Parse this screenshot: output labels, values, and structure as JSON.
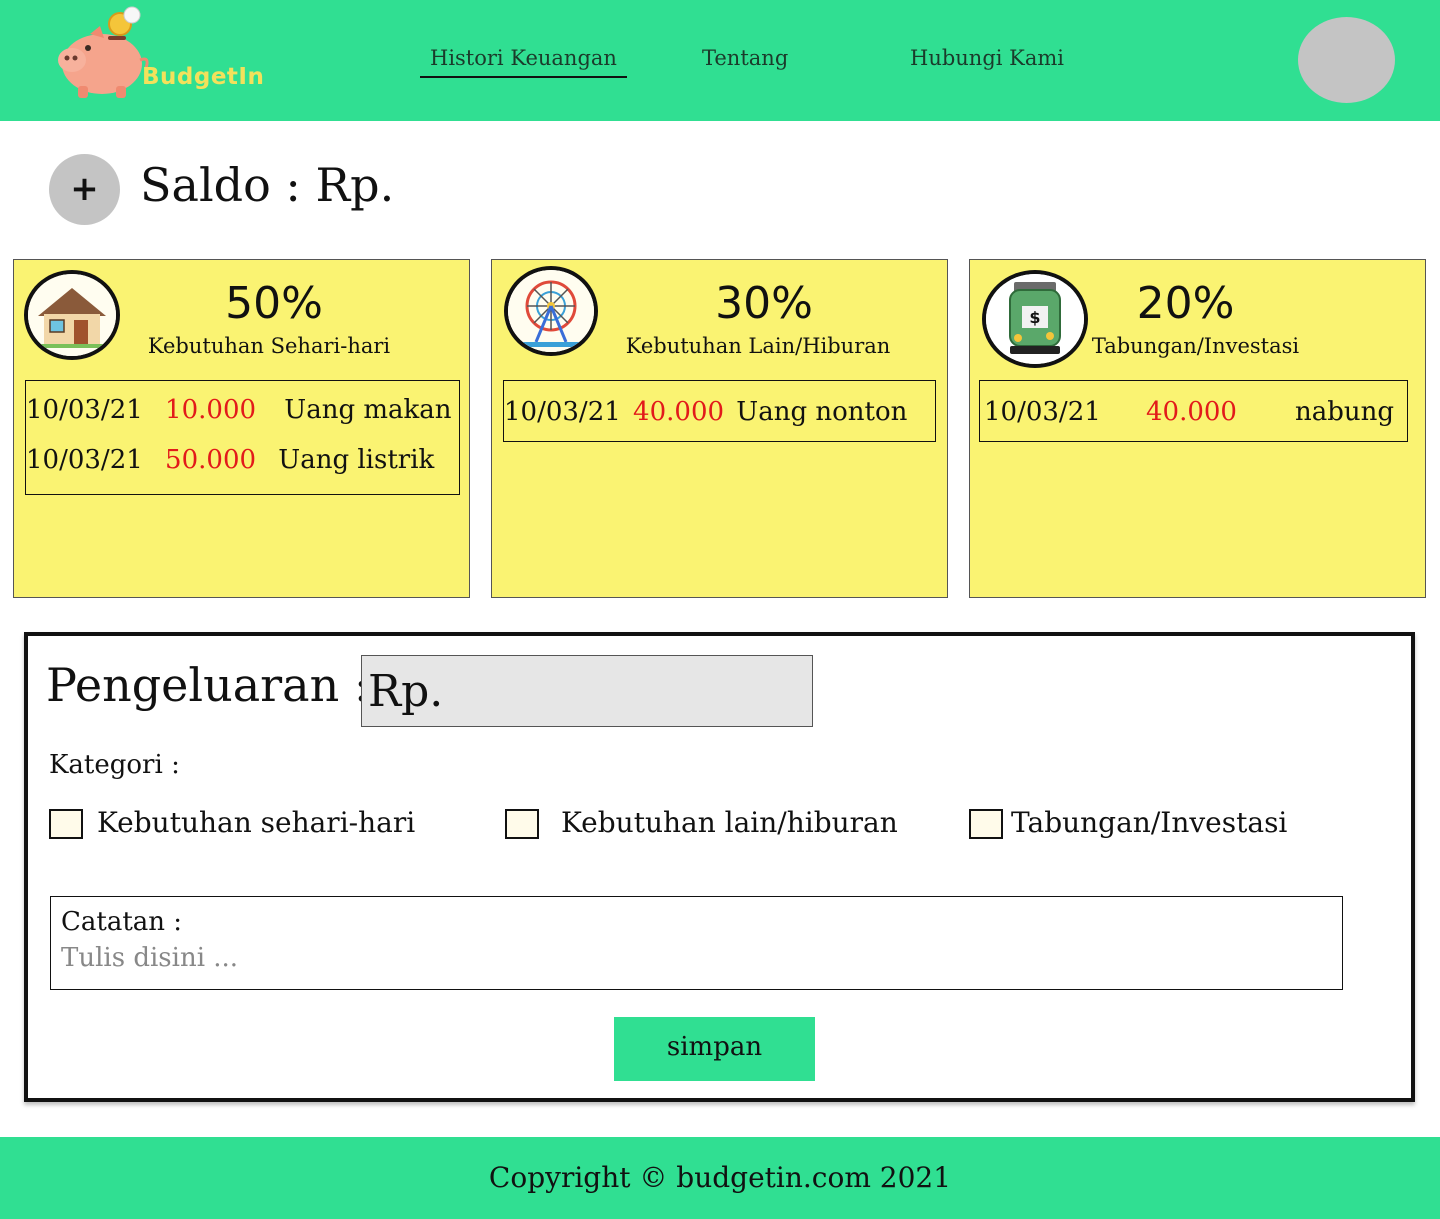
{
  "header": {
    "logo_text": "BudgetIn",
    "nav": [
      {
        "label": "Histori Keuangan",
        "active": true
      },
      {
        "label": "Tentang",
        "active": false
      },
      {
        "label": "Hubungi Kami",
        "active": false
      }
    ]
  },
  "balance": {
    "add_label": "+",
    "label": "Saldo : Rp."
  },
  "categories": [
    {
      "percent": "50%",
      "label": "Kebutuhan Sehari-hari",
      "icon": "house-icon",
      "transactions": [
        {
          "date": "10/03/21",
          "amount": "10.000",
          "note": "Uang makan"
        },
        {
          "date": "10/03/21",
          "amount": "50.000",
          "note": "Uang listrik"
        }
      ]
    },
    {
      "percent": "30%",
      "label": "Kebutuhan Lain/Hiburan",
      "icon": "ferris-wheel-icon",
      "transactions": [
        {
          "date": "10/03/21",
          "amount": "40.000",
          "note": "Uang nonton"
        }
      ]
    },
    {
      "percent": "20%",
      "label": "Tabungan/Investasi",
      "icon": "money-jar-icon",
      "transactions": [
        {
          "date": "10/03/21",
          "amount": "40.000",
          "note": "nabung"
        }
      ]
    }
  ],
  "form": {
    "title": "Pengeluaran :",
    "amount_value": "Rp.",
    "category_label": "Kategori :",
    "options": [
      "Kebutuhan sehari-hari",
      "Kebutuhan lain/hiburan",
      "Tabungan/Investasi"
    ],
    "note_label": "Catatan :",
    "note_placeholder": "Tulis disini ...",
    "save_label": "simpan"
  },
  "footer": {
    "text": "Copyright © budgetin.com 2021"
  },
  "colors": {
    "brand_green": "#30df92",
    "card_yellow": "#faf372",
    "amount_red": "#e21a1a",
    "logo_yellow": "#f3e15b"
  }
}
